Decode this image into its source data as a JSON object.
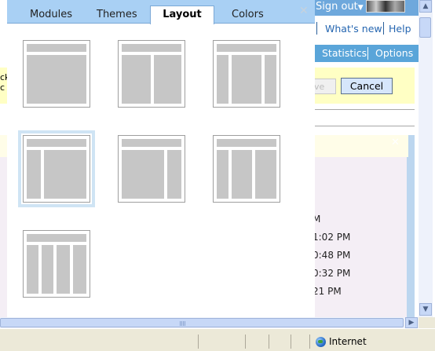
{
  "background": {
    "header": {
      "sign_out": "Sign out"
    },
    "nav_primary": [
      "What's new",
      "Help"
    ],
    "nav_secondary": [
      "Statistics",
      "Options"
    ],
    "buttons": {
      "disabled_partial": "ve",
      "cancel": "Cancel"
    },
    "left_cut_text": [
      "ck",
      "c"
    ],
    "times": [
      "M",
      "1:02 PM",
      "0:48 PM",
      "0:32 PM",
      "21 PM"
    ]
  },
  "popup": {
    "tabs": [
      {
        "label": "Modules",
        "active": false
      },
      {
        "label": "Themes",
        "active": false
      },
      {
        "label": "Layout",
        "active": true
      },
      {
        "label": "Colors",
        "active": false
      }
    ],
    "close_icon": "close-icon",
    "layouts": [
      {
        "name": "one-column",
        "selected": false
      },
      {
        "name": "two-column-wide-right",
        "selected": false
      },
      {
        "name": "three-column-wide-center",
        "selected": false
      },
      {
        "name": "two-column-narrow-left",
        "selected": true
      },
      {
        "name": "two-column-narrow-right",
        "selected": false
      },
      {
        "name": "three-column-wide-right",
        "selected": false
      },
      {
        "name": "four-column",
        "selected": false
      }
    ]
  },
  "statusbar": {
    "zone": "Internet",
    "zone_icon": "globe-icon"
  }
}
